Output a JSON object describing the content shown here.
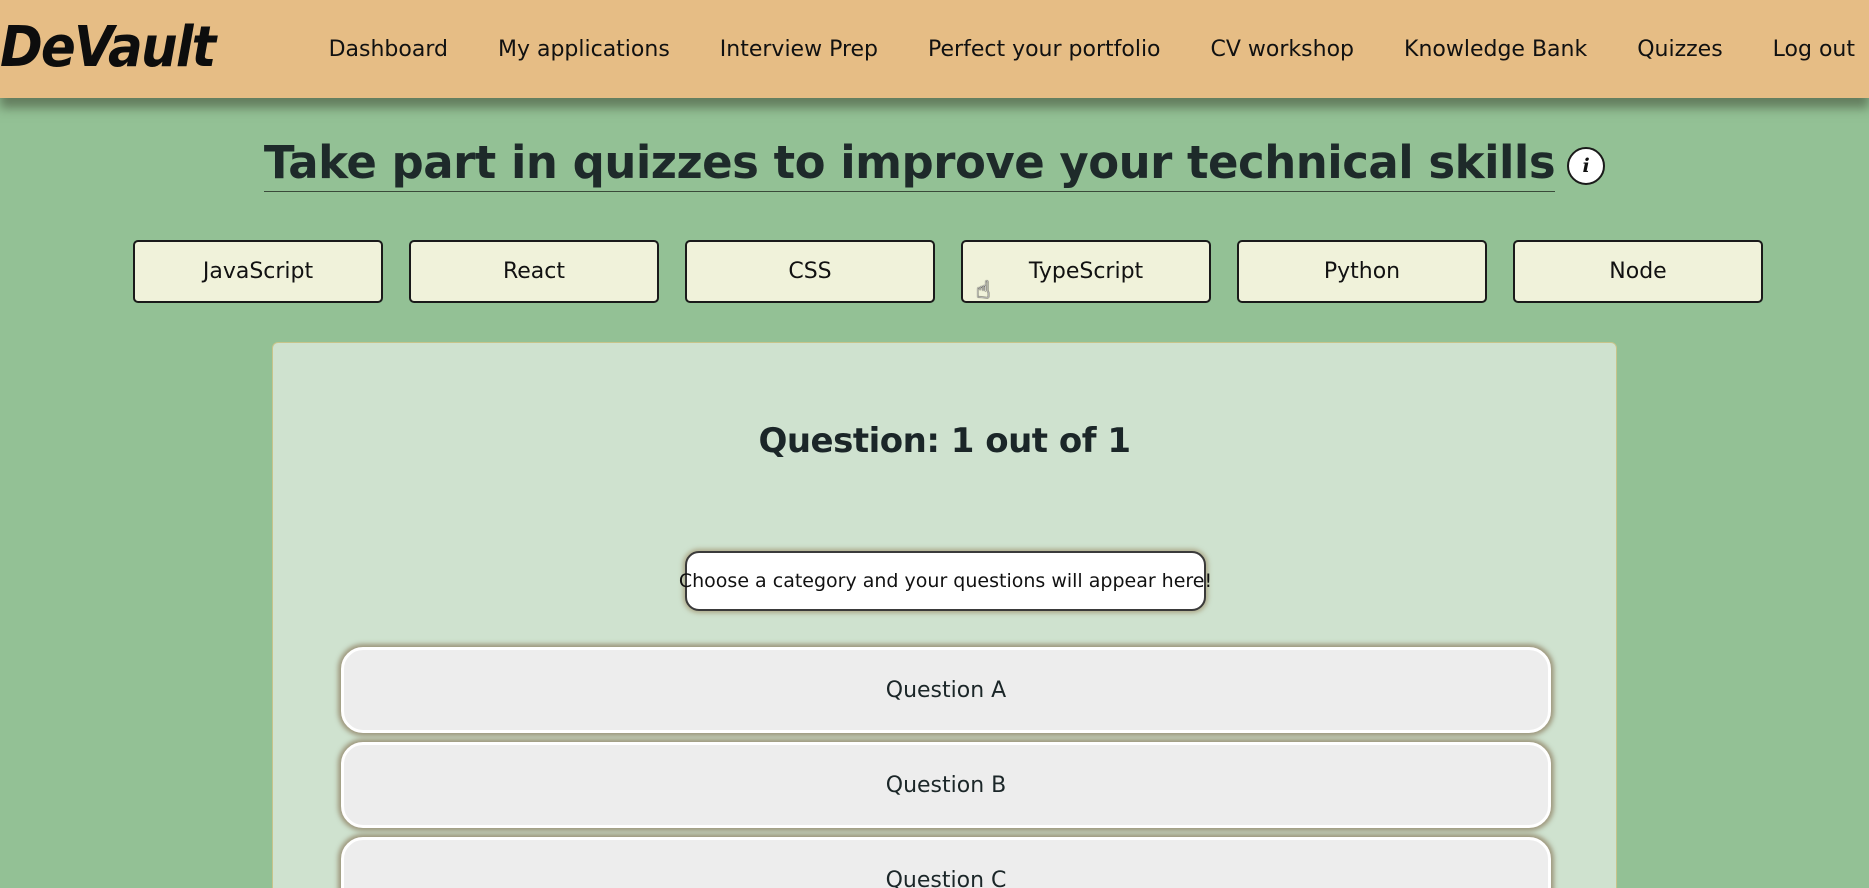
{
  "header": {
    "logo": "DeVault",
    "nav": [
      "Dashboard",
      "My applications",
      "Interview Prep",
      "Perfect your portfolio",
      "CV workshop",
      "Knowledge Bank",
      "Quizzes",
      "Log out"
    ]
  },
  "page": {
    "title": "Take part in quizzes to improve your technical skills",
    "info_icon": "i"
  },
  "categories": [
    "JavaScript",
    "React",
    "CSS",
    "TypeScript",
    "Python",
    "Node"
  ],
  "quiz": {
    "counter": "Question: 1 out of 1",
    "question": "Choose a category and your questions will appear here!",
    "answers": [
      "Question A",
      "Question B",
      "Question C"
    ]
  },
  "colors": {
    "background": "#93c195",
    "navbar": "#e6bd85",
    "panel": "#cfe2cf",
    "category_button": "#f0f2da",
    "answer_button": "#ededed"
  },
  "icons": {
    "info": "info-icon",
    "cursor": "hand-pointer-cursor"
  }
}
